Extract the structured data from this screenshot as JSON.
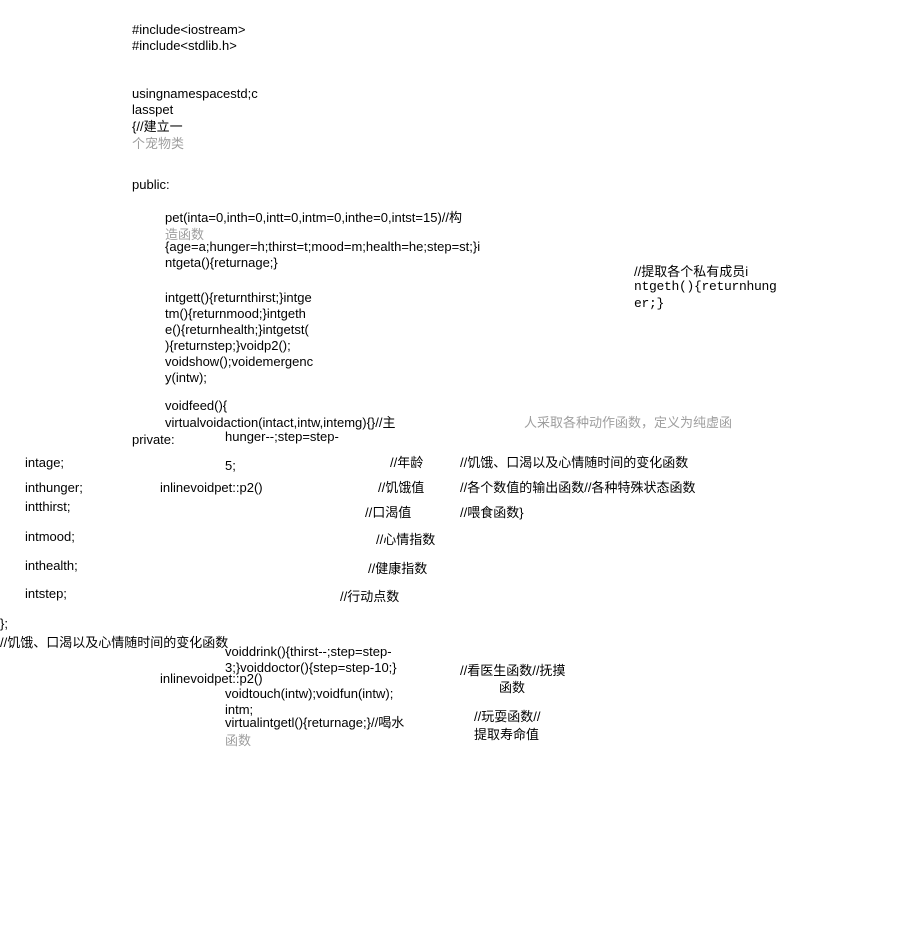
{
  "lines": {
    "l1": "#include<iostream>",
    "l2": "#include<stdlib.h>",
    "l3": "usingnamespacestd;c",
    "l4": "lasspet",
    "l5": "{//建立一",
    "l6": "个宠物类",
    "l7": "public:",
    "l8": "pet(inta=0,inth=0,intt=0,intm=0,inthe=0,intst=15)//构",
    "l9": "造函数",
    "l10": "{age=a;hunger=h;thirst=t;mood=m;health=he;step=st;}i",
    "l11": "ntgeta(){returnage;}",
    "l12": "//提取各个私有成员i",
    "l12b": "ntgeth(){returnhung",
    "l12c": "er;}",
    "l13": "intgett(){returnthirst;}intge",
    "l14": "tm(){returnmood;}intgeth",
    "l15": "e(){returnhealth;}intgetst(",
    "l16": "){returnstep;}voidp2();",
    "l17": "voidshow();voidemergenc",
    "l18": "y(intw);",
    "l19": "voidfeed(){",
    "l20": "virtualvoidaction(intact,intw,intemg){}//主",
    "l20b": "人采取各种动作函数，定义为纯虚函",
    "l21": "private:",
    "l22": "hunger--;step=step-",
    "l23": "intage;",
    "l23b": "5;",
    "l23c": "//年龄",
    "l23d": "//饥饿、口渴以及心情随时间的变化函数",
    "l24": "inthunger;",
    "l24b": "inlinevoidpet::p2()",
    "l24c": "//饥饿值",
    "l24d": "//各个数值的输出函数//各种特殊状态函数",
    "l25": "intthirst;",
    "l25c": "//口渴值",
    "l25d": "//喂食函数}",
    "l26": "intmood;",
    "l26c": "//心情指数",
    "l27": "inthealth;",
    "l27c": "//健康指数",
    "l28": "intstep;",
    "l28c": "//行动点数",
    "l29": "};",
    "l30": "//饥饿、口渴以及心情随时间的变化函数",
    "l31": "voiddrink(){thirst--;step=step-",
    "l32": "3;}voiddoctor(){step=step-10;}",
    "l32b": "inlinevoidpet::p2()",
    "l32c": "//看医生函数//抚摸",
    "l33": "voidtouch(intw);voidfun(intw);",
    "l33c": "函数",
    "l34": "intm;",
    "l34b": "virtualintgetl(){returnage;}//喝水",
    "l34c": "//玩耍函数//",
    "l35": "函数",
    "l35c": "提取寿命值"
  }
}
